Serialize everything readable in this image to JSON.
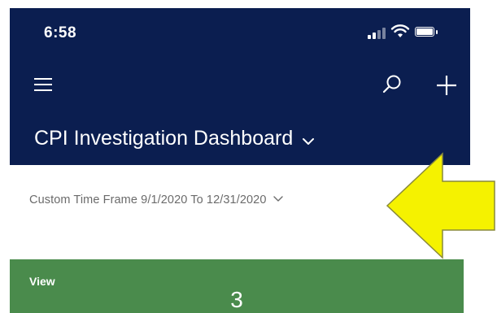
{
  "status_bar": {
    "time": "6:58"
  },
  "header": {
    "menu_icon": "hamburger-menu-icon",
    "search_icon": "search-icon",
    "add_icon": "plus-icon",
    "background_color": "#0b1e50"
  },
  "dashboard": {
    "title": "CPI Investigation Dashboard",
    "selector_icon": "chevron-down-icon"
  },
  "time_filter": {
    "label": "Custom Time Frame 9/1/2020 To 12/31/2020",
    "icon": "chevron-down-icon"
  },
  "annotation": {
    "arrow_color": "#f5f200"
  },
  "card": {
    "label": "View",
    "value": "3",
    "background_color": "#4a8b4c"
  }
}
